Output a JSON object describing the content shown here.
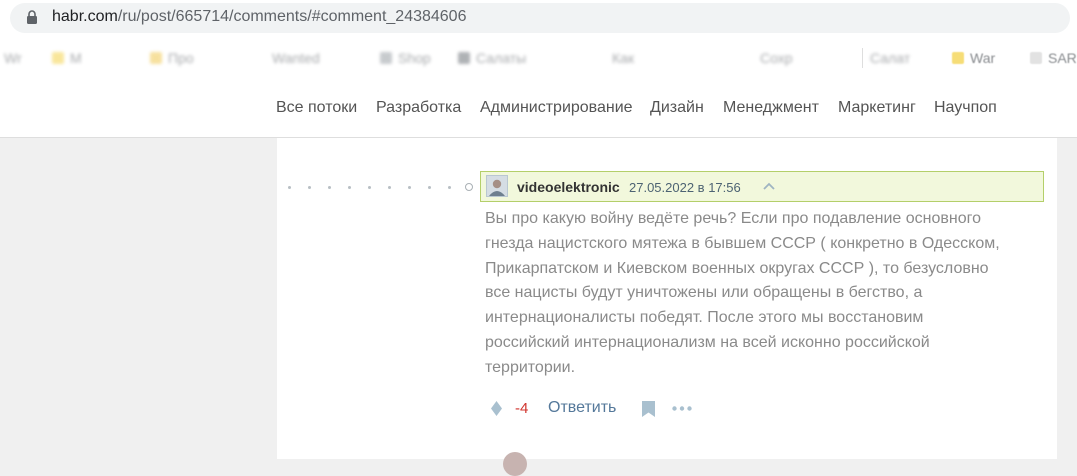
{
  "browser": {
    "url_host": "habr.com",
    "url_path": "/ru/post/665714/comments/#comment_24384606"
  },
  "bookmarks": {
    "items": [
      "Wr",
      "M",
      "Про",
      "Wanted",
      "Shop",
      "Салаты",
      "Как",
      "Сохр",
      "Салат"
    ],
    "visible_right": [
      "War",
      "SAR"
    ]
  },
  "nav": {
    "items": [
      "Все потоки",
      "Разработка",
      "Администрирование",
      "Дизайн",
      "Менеджмент",
      "Маркетинг",
      "Научпоп"
    ]
  },
  "comment": {
    "username": "videoelektronic",
    "datetime": "27.05.2022 в 17:56",
    "text_lines": [
      "Вы про какую войну ведёте речь? Если про подавление основного",
      "гнезда нацистского мятежа в бывшем СССР ( конкретно в Одесском,",
      "Прикарпатском и Киевском военных округах СССР ), то безусловно",
      "все нацисты будут уничтожены или обращены в бегство, а",
      "интернационалисты победят. После этого мы восстановим",
      "российский интернационализм на всей исконно российской",
      "территории."
    ],
    "score": "-4",
    "reply_label": "Ответить"
  },
  "icons": {
    "lock": "lock-icon",
    "to_parent": "chevron-up-icon",
    "vote": "vote-diamond-icon",
    "bookmark": "bookmark-icon",
    "more": "more-dots-icon"
  },
  "colors": {
    "highlight_bg": "#f2f8dc",
    "highlight_border": "#b4cf6a",
    "score_negative": "#d0352f",
    "link": "#54789a"
  }
}
